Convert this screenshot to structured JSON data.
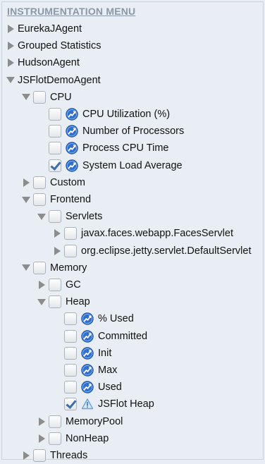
{
  "menu": {
    "title": "INSTRUMENTATION MENU"
  },
  "tree": [
    {
      "label": "EurekaJAgent",
      "indent": 0,
      "toggle": "right",
      "checkbox": false,
      "icon": null,
      "checked": false
    },
    {
      "label": "Grouped Statistics",
      "indent": 0,
      "toggle": "right",
      "checkbox": false,
      "icon": null,
      "checked": false
    },
    {
      "label": "HudsonAgent",
      "indent": 0,
      "toggle": "right",
      "checkbox": false,
      "icon": null,
      "checked": false
    },
    {
      "label": "JSFlotDemoAgent",
      "indent": 0,
      "toggle": "down",
      "checkbox": false,
      "icon": null,
      "checked": false
    },
    {
      "label": "CPU",
      "indent": 1,
      "toggle": "down",
      "checkbox": true,
      "icon": null,
      "checked": false
    },
    {
      "label": "CPU Utilization (%)",
      "indent": 2,
      "toggle": "none",
      "checkbox": true,
      "icon": "chart-icon",
      "checked": false
    },
    {
      "label": "Number of Processors",
      "indent": 2,
      "toggle": "none",
      "checkbox": true,
      "icon": "chart-icon",
      "checked": false
    },
    {
      "label": "Process CPU Time",
      "indent": 2,
      "toggle": "none",
      "checkbox": true,
      "icon": "chart-icon",
      "checked": false
    },
    {
      "label": "System Load Average",
      "indent": 2,
      "toggle": "none",
      "checkbox": true,
      "icon": "chart-icon",
      "checked": true
    },
    {
      "label": "Custom",
      "indent": 1,
      "toggle": "right",
      "checkbox": true,
      "icon": null,
      "checked": false
    },
    {
      "label": "Frontend",
      "indent": 1,
      "toggle": "down",
      "checkbox": true,
      "icon": null,
      "checked": false
    },
    {
      "label": "Servlets",
      "indent": 2,
      "toggle": "down",
      "checkbox": true,
      "icon": null,
      "checked": false
    },
    {
      "label": "javax.faces.webapp.FacesServlet",
      "indent": 3,
      "toggle": "right",
      "checkbox": true,
      "icon": null,
      "checked": false
    },
    {
      "label": "org.eclipse.jetty.servlet.DefaultServlet",
      "indent": 3,
      "toggle": "right",
      "checkbox": true,
      "icon": null,
      "checked": false
    },
    {
      "label": "Memory",
      "indent": 1,
      "toggle": "down",
      "checkbox": true,
      "icon": null,
      "checked": false
    },
    {
      "label": "GC",
      "indent": 2,
      "toggle": "right",
      "checkbox": true,
      "icon": null,
      "checked": false
    },
    {
      "label": "Heap",
      "indent": 2,
      "toggle": "down",
      "checkbox": true,
      "icon": null,
      "checked": false
    },
    {
      "label": "% Used",
      "indent": 3,
      "toggle": "none",
      "checkbox": true,
      "icon": "chart-icon",
      "checked": false
    },
    {
      "label": "Committed",
      "indent": 3,
      "toggle": "none",
      "checkbox": true,
      "icon": "chart-icon",
      "checked": false
    },
    {
      "label": "Init",
      "indent": 3,
      "toggle": "none",
      "checkbox": true,
      "icon": "chart-icon",
      "checked": false
    },
    {
      "label": "Max",
      "indent": 3,
      "toggle": "none",
      "checkbox": true,
      "icon": "chart-icon",
      "checked": false
    },
    {
      "label": "Used",
      "indent": 3,
      "toggle": "none",
      "checkbox": true,
      "icon": "chart-icon",
      "checked": false
    },
    {
      "label": "JSFlot Heap",
      "indent": 3,
      "toggle": "none",
      "checkbox": true,
      "icon": "warning-icon",
      "checked": true
    },
    {
      "label": "MemoryPool",
      "indent": 2,
      "toggle": "right",
      "checkbox": true,
      "icon": null,
      "checked": false
    },
    {
      "label": "NonHeap",
      "indent": 2,
      "toggle": "right",
      "checkbox": true,
      "icon": null,
      "checked": false
    },
    {
      "label": "Threads",
      "indent": 1,
      "toggle": "right",
      "checkbox": true,
      "icon": null,
      "checked": false
    }
  ],
  "colors": {
    "background": "#e9eef4",
    "title": "#8a97a6",
    "check": "#3f6fa8",
    "chart_icon": "#2f6fd0",
    "warning_icon": "#6aa0de"
  }
}
